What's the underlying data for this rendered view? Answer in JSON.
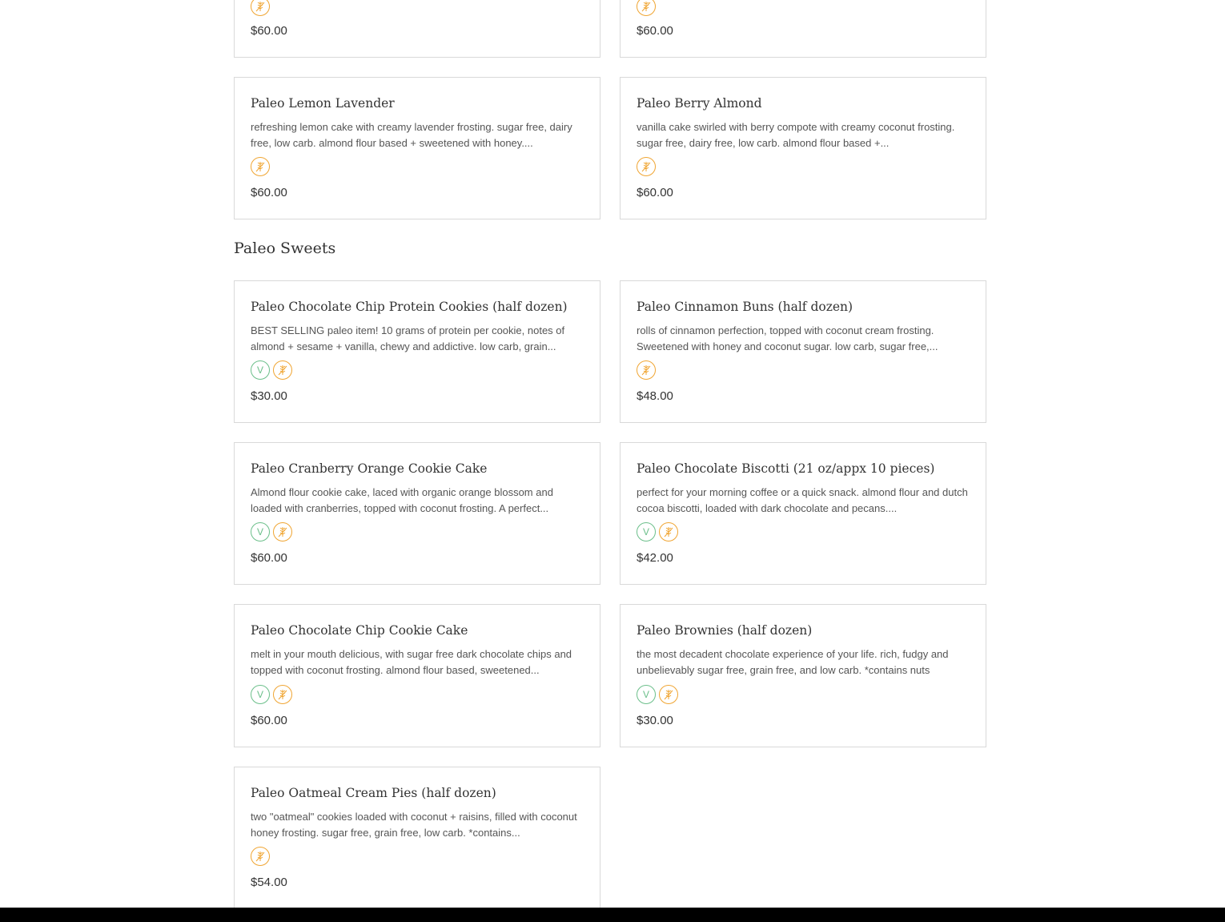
{
  "section": {
    "title": "Paleo Sweets"
  },
  "items": [
    {
      "name": "",
      "description": "",
      "price": "$60.00",
      "badges": [
        "gluten-free"
      ]
    },
    {
      "name": "",
      "description": "",
      "price": "$60.00",
      "badges": [
        "gluten-free"
      ]
    },
    {
      "name": "Paleo Lemon Lavender",
      "description": "refreshing lemon cake with creamy lavender frosting. sugar free, dairy free, low carb. almond flour based + sweetened with honey....",
      "price": "$60.00",
      "badges": [
        "gluten-free"
      ]
    },
    {
      "name": "Paleo Berry Almond",
      "description": "vanilla cake swirled with berry compote with creamy coconut frosting. sugar free, dairy free, low carb. almond flour based +...",
      "price": "$60.00",
      "badges": [
        "gluten-free"
      ]
    },
    {
      "name": "Paleo Chocolate Chip Protein Cookies (half dozen)",
      "description": "BEST SELLING paleo item! 10 grams of protein per cookie, notes of almond + sesame + vanilla, chewy and addictive. low carb, grain...",
      "price": "$30.00",
      "badges": [
        "vegan",
        "gluten-free"
      ]
    },
    {
      "name": "Paleo Cinnamon Buns (half dozen)",
      "description": "rolls of cinnamon perfection, topped with coconut cream frosting. Sweetened with honey and coconut sugar. low carb, sugar free,...",
      "price": "$48.00",
      "badges": [
        "gluten-free"
      ]
    },
    {
      "name": "Paleo Cranberry Orange Cookie Cake",
      "description": "Almond flour cookie cake, laced with organic orange blossom and loaded with cranberries, topped with coconut frosting. A perfect...",
      "price": "$60.00",
      "badges": [
        "vegan",
        "gluten-free"
      ]
    },
    {
      "name": "Paleo Chocolate Biscotti (21 oz/appx 10 pieces)",
      "description": "perfect for your morning coffee or a quick snack. almond flour and dutch cocoa biscotti, loaded with dark chocolate and pecans....",
      "price": "$42.00",
      "badges": [
        "vegan",
        "gluten-free"
      ]
    },
    {
      "name": "Paleo Chocolate Chip Cookie Cake",
      "description": "melt in your mouth delicious, with sugar free dark chocolate chips and topped with coconut frosting. almond flour based, sweetened...",
      "price": "$60.00",
      "badges": [
        "vegan",
        "gluten-free"
      ]
    },
    {
      "name": "Paleo Brownies (half dozen)",
      "description": "the most decadent chocolate experience of your life. rich, fudgy and unbelievably sugar free, grain free, and low carb. *contains nuts",
      "price": "$30.00",
      "badges": [
        "vegan",
        "gluten-free"
      ]
    },
    {
      "name": "Paleo Oatmeal Cream Pies (half dozen)",
      "description": "two \"oatmeal\" cookies loaded with coconut + raisins, filled with coconut honey frosting. sugar free, grain free, low carb. *contains...",
      "price": "$54.00",
      "badges": [
        "gluten-free"
      ]
    }
  ],
  "badge_labels": {
    "vegan": "V"
  },
  "icons": {
    "vegan": "vegan-icon",
    "gluten-free": "gluten-free-icon"
  },
  "colors": {
    "vegan": "#6bbf8a",
    "gluten_free": "#f0a532",
    "card_border": "#d9d9d9",
    "footer": "#000000"
  }
}
